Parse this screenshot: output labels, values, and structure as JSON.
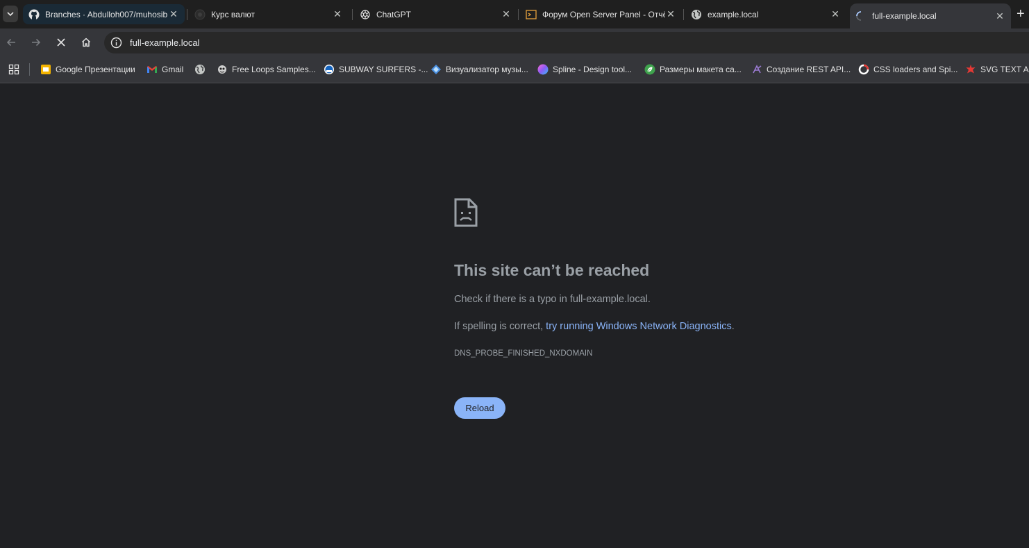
{
  "tabs": [
    {
      "title": "Branches · Abdulloh007/muhosib",
      "favicon": "github-icon"
    },
    {
      "title": "Курс валют",
      "favicon": "dark-circle-icon"
    },
    {
      "title": "ChatGPT",
      "favicon": "openai-icon"
    },
    {
      "title": "Форум Open Server Panel - Отчёты",
      "favicon": "terminal-icon"
    },
    {
      "title": "example.local",
      "favicon": "globe-icon"
    },
    {
      "title": "full-example.local",
      "favicon": "loading-spinner-icon",
      "active": true
    }
  ],
  "address_bar": {
    "url": "full-example.local"
  },
  "bookmarks": [
    {
      "label": "Google Презентации",
      "icon": "google-slides-icon"
    },
    {
      "label": "Gmail",
      "icon": "gmail-icon"
    },
    {
      "label": "",
      "icon": "globe-icon"
    },
    {
      "label": "Free Loops Samples...",
      "icon": "loops-icon"
    },
    {
      "label": "SUBWAY SURFERS -...",
      "icon": "subway-icon"
    },
    {
      "label": "Визуализатор музы...",
      "icon": "visualizer-icon"
    },
    {
      "label": "Spline - Design tool...",
      "icon": "spline-icon"
    },
    {
      "label": "Размеры макета са...",
      "icon": "leaf-icon"
    },
    {
      "label": "Создание REST API...",
      "icon": "api-icon"
    },
    {
      "label": "CSS loaders and Spi...",
      "icon": "loader-ring-icon"
    },
    {
      "label": "SVG TEXT ANIMATION",
      "icon": "svg-star-icon"
    }
  ],
  "error_page": {
    "title": "This site can’t be reached",
    "line1": "Check if there is a typo in full-example.local.",
    "line2_prefix": "If spelling is correct, ",
    "line2_link": "try running Windows Network Diagnostics",
    "line2_suffix": ".",
    "error_code": "DNS_PROBE_FINISHED_NXDOMAIN",
    "reload_label": "Reload"
  },
  "colors": {
    "page_bg": "#202124",
    "link": "#8ab4f8",
    "button_bg": "#8ab4f8",
    "text_muted": "#9aa0a6"
  }
}
